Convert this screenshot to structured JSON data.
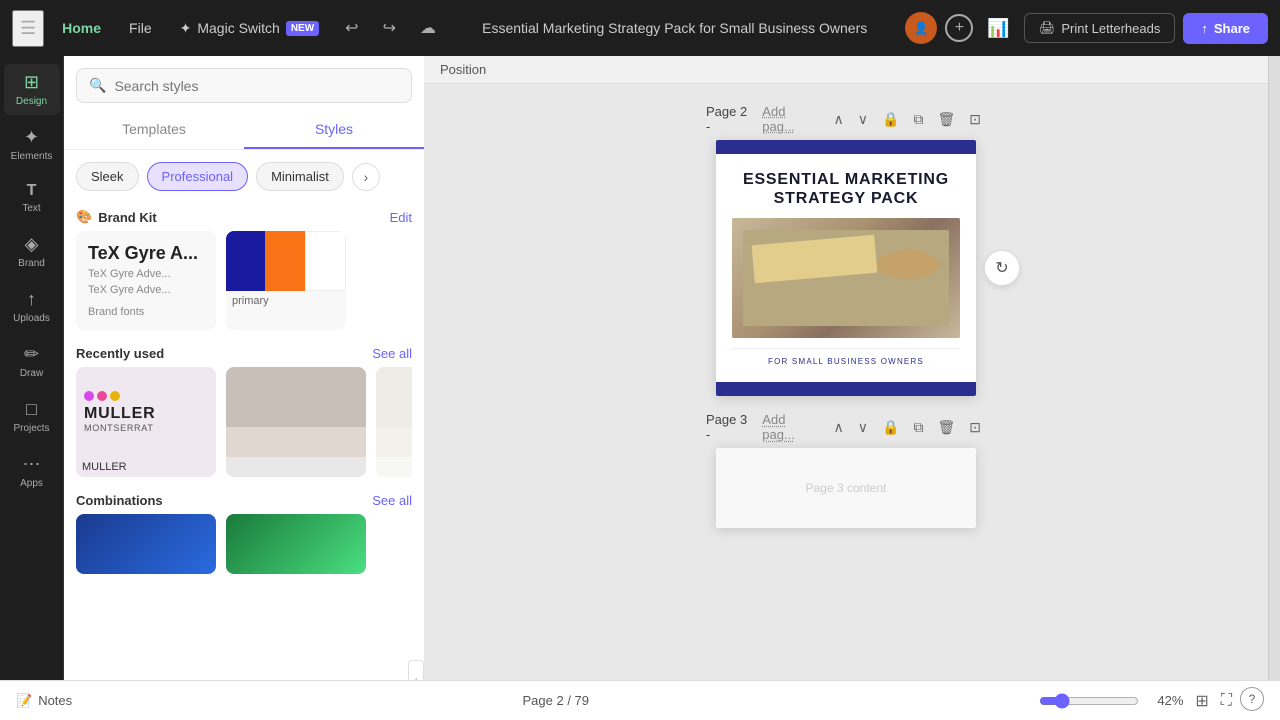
{
  "topbar": {
    "home_label": "Home",
    "file_label": "File",
    "magic_switch_label": "Magic Switch",
    "new_badge": "NEW",
    "title": "Essential Marketing Strategy Pack for Small Business Owners",
    "print_label": "Print Letterheads",
    "share_label": "Share"
  },
  "sidebar_icons": [
    {
      "id": "design",
      "icon": "⊞",
      "label": "Design",
      "active": true
    },
    {
      "id": "elements",
      "icon": "✦",
      "label": "Elements"
    },
    {
      "id": "text",
      "icon": "T",
      "label": "Text"
    },
    {
      "id": "brand",
      "icon": "◈",
      "label": "Brand"
    },
    {
      "id": "uploads",
      "icon": "↑",
      "label": "Uploads"
    },
    {
      "id": "draw",
      "icon": "✏",
      "label": "Draw"
    },
    {
      "id": "projects",
      "icon": "□",
      "label": "Projects"
    },
    {
      "id": "apps",
      "icon": "⋯",
      "label": "Apps"
    }
  ],
  "styles_panel": {
    "search_placeholder": "Search styles",
    "tab_templates": "Templates",
    "tab_styles": "Styles",
    "chips": [
      "Sleek",
      "Professional",
      "Minimalist"
    ],
    "chip_active": "Professional",
    "brand_kit": {
      "title": "Brand Kit",
      "edit_label": "Edit",
      "brand_fonts_label": "Brand fonts",
      "font_name": "TeX Gyre A...",
      "font_sub1": "TeX Gyre Adve...",
      "font_sub2": "TeX Gyre Adve...",
      "primary_label": "primary",
      "swatches": [
        "#1a1a9e",
        "#f97316",
        "#ffffff"
      ]
    },
    "recently_used": {
      "title": "Recently used",
      "see_all": "See all",
      "cards": [
        {
          "type": "muller",
          "title": "MULLER",
          "sub": "MONTSERRAT"
        },
        {
          "type": "grey"
        }
      ]
    },
    "combinations": {
      "title": "Combinations",
      "see_all": "See all"
    }
  },
  "canvas": {
    "position_label": "Position",
    "page2": {
      "label": "Page 2",
      "add_page": "Add pag...",
      "title_line1": "ESSENTIAL MARKETING",
      "title_line2": "STRATEGY PACK",
      "subtitle": "FOR SMALL BUSINESS OWNERS"
    },
    "page3": {
      "label": "Page 3",
      "add_page": "Add pag..."
    }
  },
  "bottom_bar": {
    "notes_label": "Notes",
    "page_count": "Page 2 / 79",
    "zoom_percent": "42%"
  }
}
